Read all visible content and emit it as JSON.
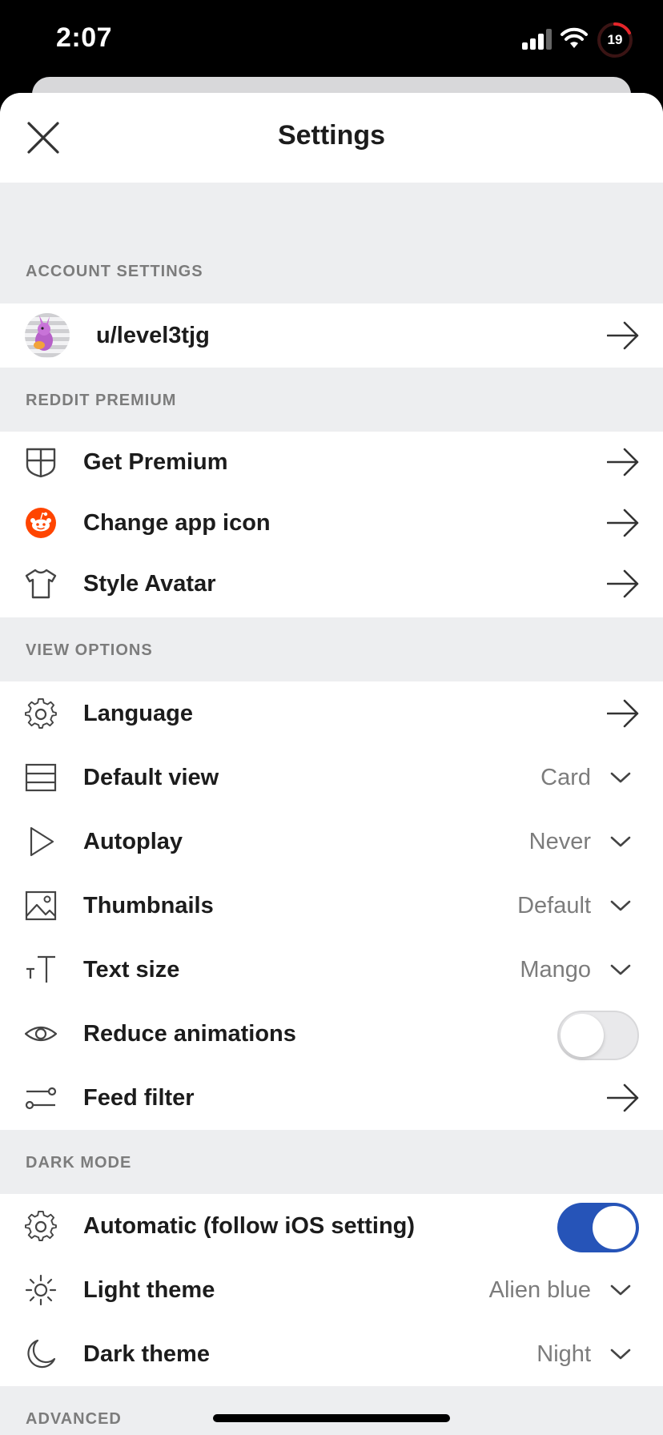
{
  "status_bar": {
    "time": "2:07",
    "battery": "19"
  },
  "header": {
    "title": "Settings"
  },
  "sections": {
    "account": {
      "label": "ACCOUNT SETTINGS",
      "username": "u/level3tjg"
    },
    "premium": {
      "label": "REDDIT PREMIUM",
      "items": [
        {
          "label": "Get Premium",
          "icon": "shield-icon"
        },
        {
          "label": "Change app icon",
          "icon": "reddit-logo-icon"
        },
        {
          "label": "Style Avatar",
          "icon": "shirt-icon"
        }
      ]
    },
    "view": {
      "label": "VIEW OPTIONS",
      "items": [
        {
          "label": "Language",
          "icon": "gear-icon"
        },
        {
          "label": "Default view",
          "value": "Card",
          "icon": "card-view-icon"
        },
        {
          "label": "Autoplay",
          "value": "Never",
          "icon": "play-icon"
        },
        {
          "label": "Thumbnails",
          "value": "Default",
          "icon": "image-icon"
        },
        {
          "label": "Text size",
          "value": "Mango",
          "icon": "text-size-icon"
        },
        {
          "label": "Reduce animations",
          "toggle": false,
          "icon": "eye-icon"
        },
        {
          "label": "Feed filter",
          "icon": "filter-icon"
        }
      ]
    },
    "dark_mode": {
      "label": "DARK MODE",
      "items": [
        {
          "label": "Automatic (follow iOS setting)",
          "toggle": true,
          "icon": "gear-icon"
        },
        {
          "label": "Light theme",
          "value": "Alien blue",
          "icon": "sun-icon"
        },
        {
          "label": "Dark theme",
          "value": "Night",
          "icon": "moon-icon"
        }
      ]
    },
    "advanced": {
      "label": "ADVANCED"
    }
  },
  "colors": {
    "toggle_on": "#2654b8",
    "reddit_orange": "#ff4500",
    "section_bg": "#edeef0"
  }
}
